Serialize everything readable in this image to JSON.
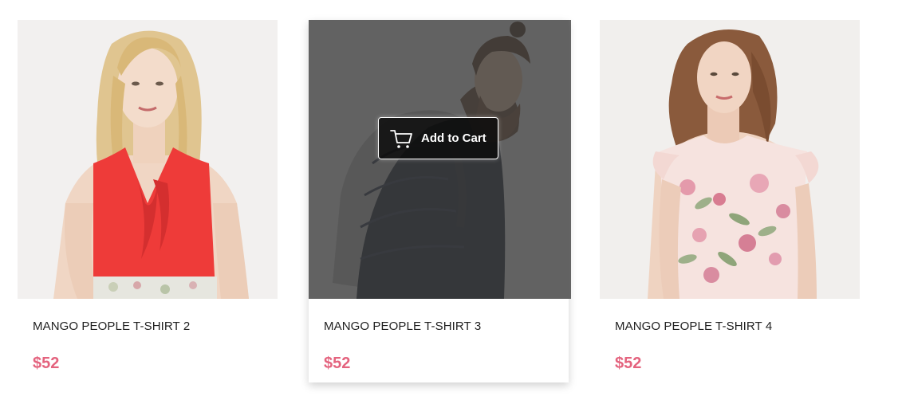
{
  "products": [
    {
      "title": "MANGO PEOPLE T-SHIRT 2",
      "price": "$52"
    },
    {
      "title": "MANGO PEOPLE T-SHIRT 3",
      "price": "$52",
      "hover_action": "Add to Cart"
    },
    {
      "title": "MANGO PEOPLE T-SHIRT 4",
      "price": "$52"
    }
  ],
  "colors": {
    "price": "#e4637e",
    "title": "#222222",
    "overlay": "#3c3c3c"
  },
  "icons": {
    "add_to_cart": "shopping-cart-icon"
  }
}
